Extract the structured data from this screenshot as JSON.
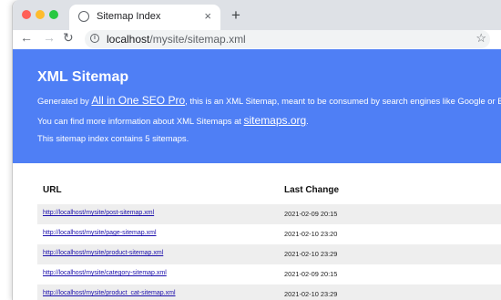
{
  "browser": {
    "tab_title": "Sitemap Index",
    "tab_close": "×",
    "new_tab": "+",
    "url_host": "localhost",
    "url_path": "/mysite/sitemap.xml",
    "icons": {
      "back": "←",
      "forward": "→",
      "reload": "↻",
      "star": "☆",
      "info": "i",
      "favicon": "◐"
    }
  },
  "hero": {
    "title": "XML Sitemap",
    "line1_prefix": "Generated by ",
    "line1_link": "All in One SEO Pro",
    "line1_suffix": ", this is an XML Sitemap, meant to be consumed by search engines like Google or Bing.",
    "line2_prefix": "You can find more information about XML Sitemaps at ",
    "line2_link": "sitemaps.org",
    "line2_suffix": ".",
    "line3": "This sitemap index contains 5 sitemaps.",
    "background": "#4f7ff5"
  },
  "table": {
    "headers": {
      "url": "URL",
      "last_change": "Last Change"
    },
    "rows": [
      {
        "url": "http://localhost/mysite/post-sitemap.xml",
        "date": "2021-02-09 20:15"
      },
      {
        "url": "http://localhost/mysite/page-sitemap.xml",
        "date": "2021-02-10 23:20"
      },
      {
        "url": "http://localhost/mysite/product-sitemap.xml",
        "date": "2021-02-10 23:29"
      },
      {
        "url": "http://localhost/mysite/category-sitemap.xml",
        "date": "2021-02-09 20:15"
      },
      {
        "url": "http://localhost/mysite/product_cat-sitemap.xml",
        "date": "2021-02-10 23:29"
      }
    ]
  }
}
